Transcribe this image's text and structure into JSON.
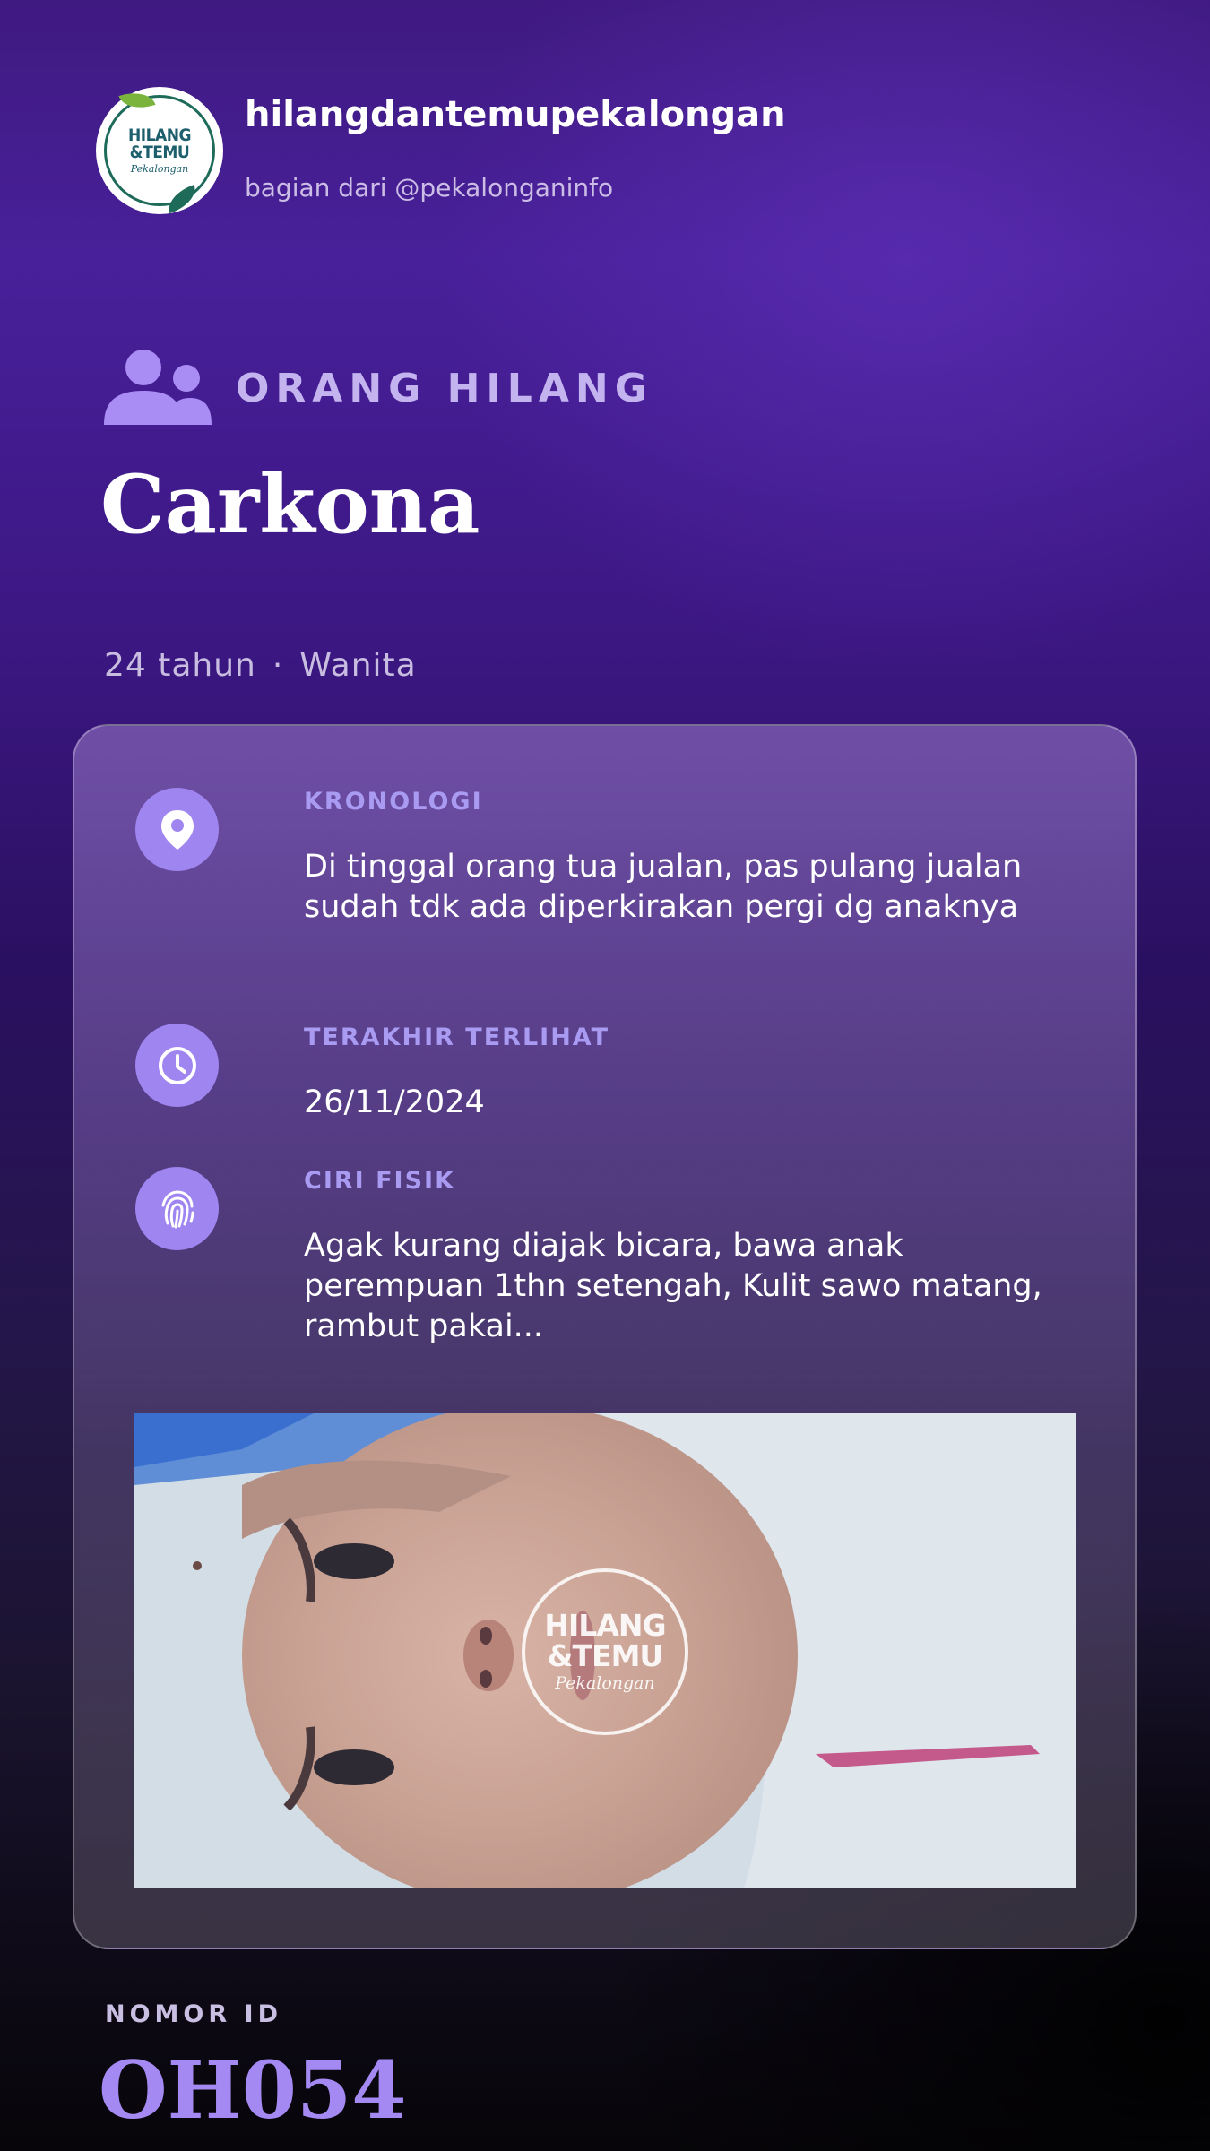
{
  "account": {
    "name": "hilangdantemupekalongan",
    "subtitle": "bagian dari @pekalonganinfo",
    "logo_text_line1": "HILANG",
    "logo_text_line2": "&TEMU",
    "logo_script": "Pekalongan"
  },
  "category": {
    "label": "ORANG HILANG",
    "icon": "people-icon"
  },
  "person": {
    "name": "Carkona",
    "age": "24 tahun",
    "separator": "·",
    "gender": "Wanita"
  },
  "details": {
    "kronologi": {
      "label": "KRONOLOGI",
      "icon": "location-pin-icon",
      "value": "Di tinggal orang tua jualan, pas pulang jualan sudah tdk ada diperkirakan pergi dg anaknya"
    },
    "terakhir_terlihat": {
      "label": "TERAKHIR TERLIHAT",
      "icon": "clock-icon",
      "value": "26/11/2024"
    },
    "ciri_fisik": {
      "label": "CIRI FISIK",
      "icon": "fingerprint-icon",
      "value": "Agak kurang diajak bicara, bawa anak perempuan 1thn setengah, Kulit sawo matang, rambut pakai..."
    }
  },
  "photo": {
    "watermark_line1": "HILANG",
    "watermark_line2": "&TEMU",
    "watermark_script": "Pekalongan"
  },
  "id": {
    "label": "NOMOR ID",
    "value": "OH054"
  },
  "colors": {
    "accent": "#a489f3",
    "icon_bg": "#9f85f0",
    "label": "#a99af2",
    "background_top": "#48209a",
    "background_bottom": "#070509"
  }
}
